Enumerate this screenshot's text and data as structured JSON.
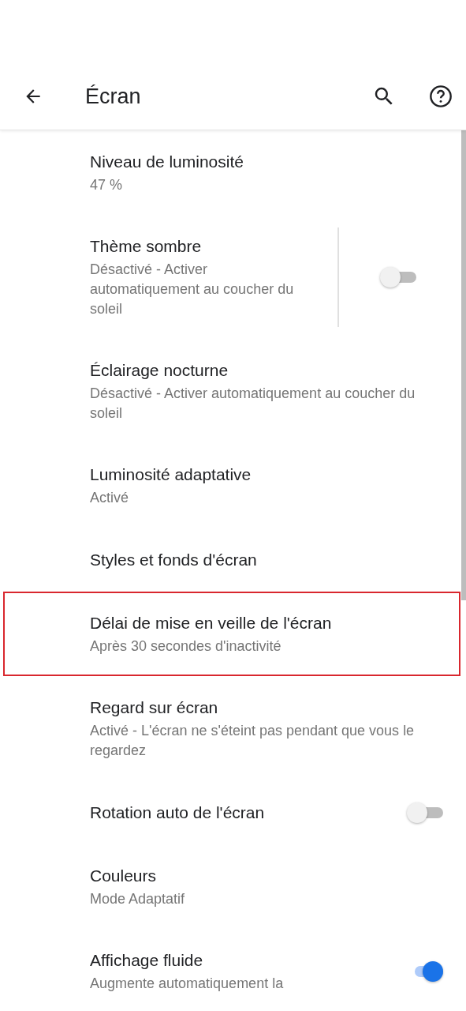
{
  "header": {
    "title": "Écran"
  },
  "settings": [
    {
      "kind": "text",
      "title": "Niveau de luminosité",
      "summary": "47 %",
      "highlighted": false
    },
    {
      "kind": "split_toggle",
      "title": "Thème sombre",
      "summary": "Désactivé - Activer automatiquement au coucher du soleil",
      "on": false,
      "highlighted": false
    },
    {
      "kind": "text",
      "title": "Éclairage nocturne",
      "summary": "Désactivé - Activer automatiquement au coucher du soleil",
      "highlighted": false
    },
    {
      "kind": "text",
      "title": "Luminosité adaptative",
      "summary": "Activé",
      "highlighted": false
    },
    {
      "kind": "text",
      "title": "Styles et fonds d'écran",
      "highlighted": false
    },
    {
      "kind": "text",
      "title": "Délai de mise en veille de l'écran",
      "summary": "Après 30 secondes d'inactivité",
      "highlighted": true
    },
    {
      "kind": "text",
      "title": "Regard sur écran",
      "summary": "Activé - L'écran ne s'éteint pas pendant que vous le regardez",
      "highlighted": false
    },
    {
      "kind": "toggle",
      "title": "Rotation auto de l'écran",
      "on": false,
      "highlighted": false
    },
    {
      "kind": "text",
      "title": "Couleurs",
      "summary": "Mode Adaptatif",
      "highlighted": false
    },
    {
      "kind": "toggle",
      "title": "Affichage fluide",
      "summary": "Augmente automatiquement la",
      "on": true,
      "highlighted": false
    }
  ]
}
